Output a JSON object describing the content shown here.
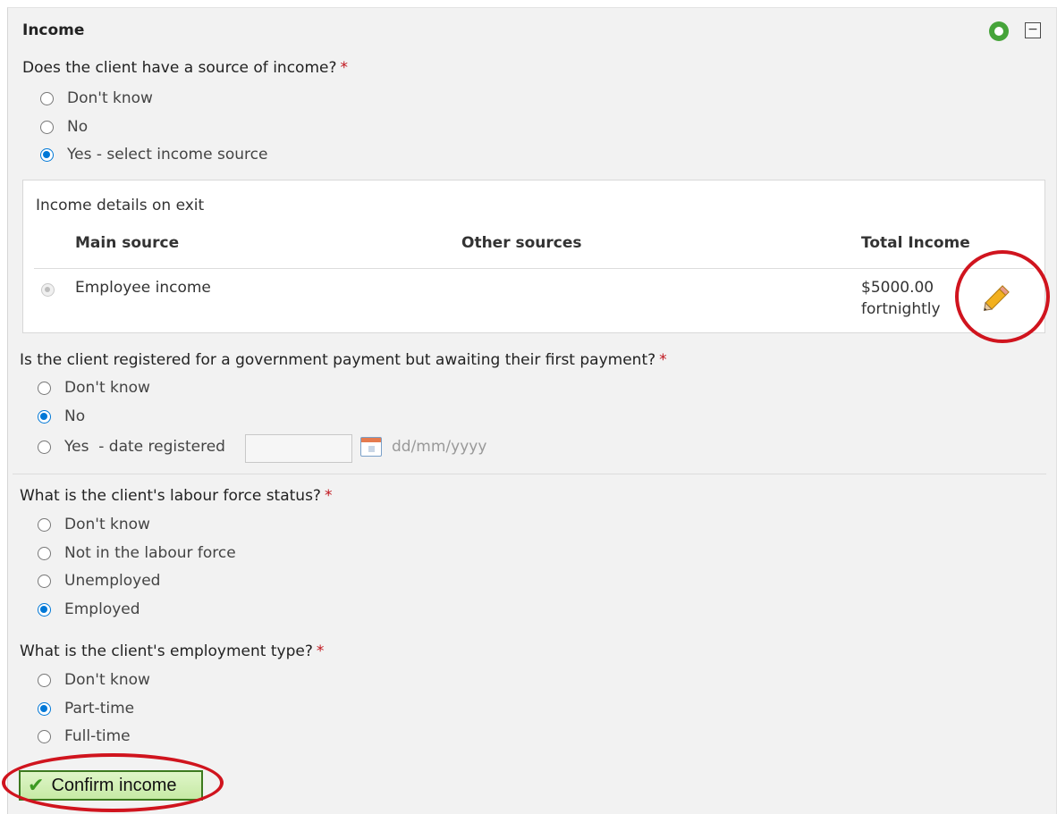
{
  "section": {
    "title": "Income"
  },
  "q1": {
    "question": "Does the client have a source of income?",
    "required": "*",
    "options": [
      "Don't know",
      "No",
      "Yes - select income source"
    ],
    "selected": 2
  },
  "income_table": {
    "title": "Income details on exit",
    "columns": [
      "Main source",
      "Other sources",
      "Total Income"
    ],
    "row": {
      "main_source": "Employee income",
      "other_sources": "",
      "amount": "$5000.00",
      "frequency": "fortnightly"
    }
  },
  "q2": {
    "question": "Is the client registered for a government payment but awaiting their first payment?",
    "required": "*",
    "options": [
      "Don't know",
      "No",
      "Yes  - date registered"
    ],
    "selected": 1,
    "date_placeholder": "dd/mm/yyyy"
  },
  "q3": {
    "question": "What is the client's labour force status?",
    "required": "*",
    "options": [
      "Don't know",
      "Not in the labour force",
      "Unemployed",
      "Employed"
    ],
    "selected": 3
  },
  "q4": {
    "question": "What is the client's employment type?",
    "required": "*",
    "options": [
      "Don't know",
      "Part-time",
      "Full-time"
    ],
    "selected": 1
  },
  "confirm_button": {
    "label": "Confirm income"
  },
  "icons": {
    "status": "status-circle-icon",
    "collapse": "collapse-icon",
    "edit": "pencil-icon",
    "calendar": "calendar-icon",
    "check": "checkmark-icon"
  },
  "colors": {
    "accent": "#0078d7",
    "required": "#c0141c",
    "annotation": "#d0141e",
    "button_bg": "#c6eaa5"
  }
}
